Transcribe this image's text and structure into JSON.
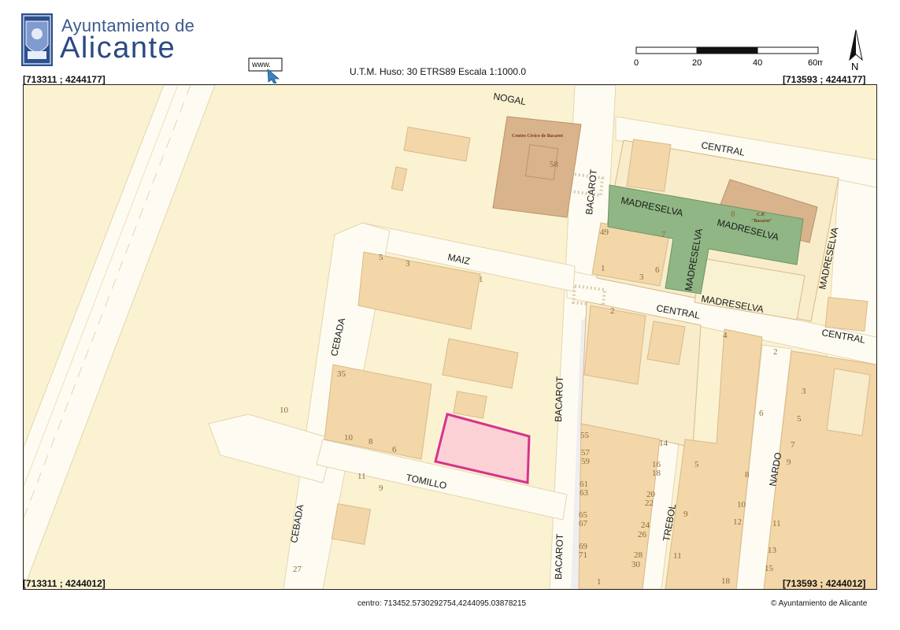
{
  "header": {
    "logo_small": "Ayuntamiento de",
    "logo_big": "Alicante",
    "www_label": "www.",
    "projection_info": "U.T.M. Huso: 30 ETRS89 Escala 1:1000.0"
  },
  "scale_bar": {
    "labels": [
      "0",
      "20",
      "40",
      "60m"
    ]
  },
  "north_arrow": {
    "label": "N"
  },
  "corners": {
    "top_left": "[713311 ; 4244177]",
    "top_right": "[713593 ; 4244177]",
    "bottom_left": "[713311 ; 4244012]",
    "bottom_right": "[713593 ; 4244012]"
  },
  "map": {
    "colors": {
      "background": "#fbf2d2",
      "road": "#fefcf2",
      "block": "#f8eccb",
      "building": "#f3d7a8",
      "building_stroke": "#d8b98b",
      "civic": "#d9b38c",
      "park": "#8fb684",
      "highlight_fill": "#fbd1d5",
      "highlight_stroke": "#d6338f",
      "label": "#1a1a1a",
      "number": "#8a6a3a"
    },
    "streets": {
      "nogal": "NOGAL",
      "central_1": "CENTRAL",
      "central_2": "CENTRAL",
      "central_3": "CENTRAL",
      "bacarot_1": "BACAROT",
      "bacarot_2": "BACAROT",
      "bacarot_3": "BACAROT",
      "madreselva_1": "MADRESELVA",
      "madreselva_2": "MADRESELVA",
      "madreselva_3": "MADRESELVA",
      "madreselva_4": "MADRESELVA",
      "madreselva_5": "MADRESELVA",
      "maiz": "MAIZ",
      "cebada_1": "CEBADA",
      "cebada_2": "CEBADA",
      "tomillo": "TOMILLO",
      "trebol": "TREBOL",
      "nardo": "NARDO"
    },
    "places": {
      "centro_civico": "Centro Cívico de Bacarot",
      "cp_line1": "C.P.",
      "cp_line2": "\"Bacarot\""
    },
    "numbers": {
      "n58": "58",
      "n8a": "8",
      "n49": "49",
      "n7a": "7",
      "n1a": "1",
      "n3a": "3",
      "n6a": "6",
      "n5a": "5",
      "n3b": "3",
      "n1b": "1",
      "n35": "35",
      "n10a": "10",
      "n8b": "8",
      "n6b": "6",
      "n10b": "10",
      "n11a": "11",
      "n9a": "9",
      "n27": "27",
      "n2a": "2",
      "n4": "4",
      "n2b": "2",
      "n3c": "3",
      "n5b": "5",
      "n6c": "6",
      "n7b": "7",
      "n9b": "9",
      "n8c": "8",
      "n10c": "10",
      "n12": "12",
      "n11b": "11",
      "n13": "13",
      "n15": "15",
      "n55": "55",
      "n57": "57",
      "n59": "59",
      "n61": "61",
      "n63": "63",
      "n65": "65",
      "n67": "67",
      "n69": "69",
      "n71": "71",
      "n1c": "1",
      "n14": "14",
      "n16": "16",
      "n18a": "18",
      "n20": "20",
      "n22": "22",
      "n24": "24",
      "n26": "26",
      "n28": "28",
      "n30": "30",
      "n5c": "5",
      "n9c": "9",
      "n11c": "11",
      "n18b": "18"
    }
  },
  "footer": {
    "center": "centro: 713452.5730292754,4244095.03878215",
    "copyright": "© Ayuntamiento de Alicante"
  }
}
